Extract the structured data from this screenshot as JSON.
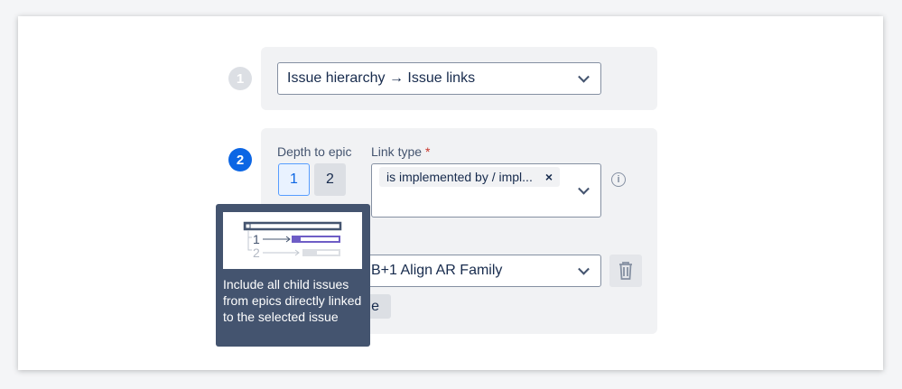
{
  "step1": {
    "number": "1",
    "select_value": "Issue hierarchy → Issue links"
  },
  "step2": {
    "number": "2",
    "depth_label": "Depth to epic",
    "depth_options": [
      "1",
      "2"
    ],
    "link_type_label": "Link type",
    "required_mark": "*",
    "link_type_tag": "is implemented by / impl...",
    "tag_remove": "×",
    "issue_select_value": "B+1 Align AR Family",
    "partial_button_label": "e"
  },
  "tooltip": {
    "text": "Include all child issues from epics directly linked to the selected issue",
    "diagram_labels": [
      "1",
      "2"
    ]
  },
  "colors": {
    "accent": "#0c66e4",
    "tooltip_bg": "#44546f",
    "purple": "#6e5dc6"
  }
}
